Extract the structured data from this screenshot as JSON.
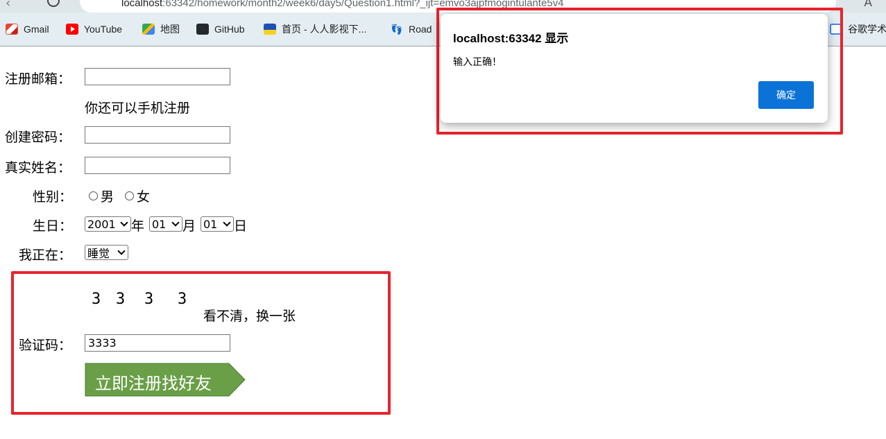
{
  "browser": {
    "url_host": "localhost",
    "url_rest": ":63342/homework/month2/week6/day5/Question1.html?_ijt=emvo3ajpfmogintulante5v4",
    "bookmarks": [
      "Gmail",
      "YouTube",
      "地图",
      "GitHub",
      "首页 - 人人影视下...",
      "Road",
      "谷歌学术"
    ]
  },
  "form": {
    "email_label": "注册邮箱：",
    "phone_hint": "你还可以手机注册",
    "password_label": "创建密码：",
    "name_label": "真实姓名：",
    "gender_label": "性别：",
    "gender_male": "男",
    "gender_female": "女",
    "birthday_label": "生日：",
    "year_value": "2001",
    "year_unit": "年",
    "month_value": "01",
    "month_unit": "月",
    "day_value": "01",
    "day_unit": "日",
    "status_label": "我正在：",
    "status_value": "睡觉",
    "captcha_digits": [
      "3",
      "3",
      "3",
      "3"
    ],
    "captcha_refresh": "看不清，换一张",
    "captcha_label": "验证码：",
    "captcha_value": "3333",
    "submit_label": "立即注册找好友"
  },
  "dialog": {
    "title": "localhost:63342 显示",
    "message": "输入正确！",
    "ok_label": "确定"
  },
  "colors": {
    "submit_green": "#6a9f48",
    "highlight_red": "#e8232d",
    "dialog_blue": "#0b73d7"
  }
}
